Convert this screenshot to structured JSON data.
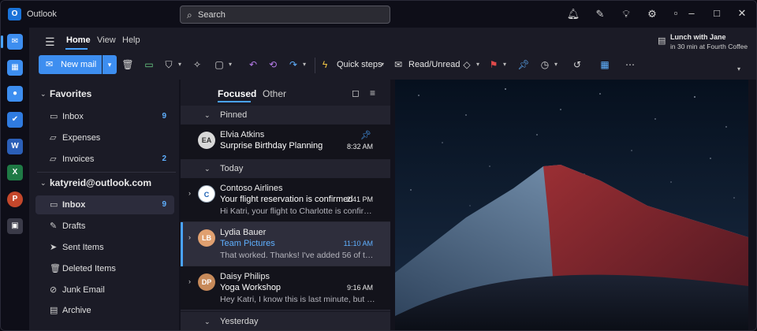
{
  "app": {
    "name": "Outlook",
    "logo": "O"
  },
  "search": {
    "placeholder": "Search"
  },
  "titlebar_icons": [
    "bell-icon",
    "sticky-note-icon",
    "lightbulb-icon",
    "gear-icon"
  ],
  "window_controls": [
    "restore-icon",
    "minimize-icon",
    "maximize-icon",
    "close-icon"
  ],
  "rail": [
    {
      "name": "mail-icon",
      "glyph": "✉",
      "color": "#3d8ef0"
    },
    {
      "name": "calendar-icon",
      "glyph": "▦",
      "color": "#3d8ef0"
    },
    {
      "name": "people-icon",
      "glyph": "●",
      "color": "#3d8ef0"
    },
    {
      "name": "todo-icon",
      "glyph": "✔",
      "color": "#2f7be0"
    },
    {
      "name": "word-icon",
      "glyph": "W",
      "color": "#2b5fb8"
    },
    {
      "name": "excel-icon",
      "glyph": "X",
      "color": "#1f7a45"
    },
    {
      "name": "powerpoint-icon",
      "glyph": "P",
      "color": "#c4472b"
    },
    {
      "name": "apps-icon",
      "glyph": "▣",
      "color": "#3a3a48"
    }
  ],
  "ribbon": {
    "tabs": [
      "Home",
      "View",
      "Help"
    ],
    "active_tab": "Home",
    "new_mail": "New mail",
    "quick_steps": "Quick steps",
    "read_unread": "Read/Unread"
  },
  "reminder": {
    "title": "Lunch with Jane",
    "subtitle": "in 30 min at Fourth Coffee"
  },
  "favorites": {
    "header": "Favorites",
    "items": [
      {
        "label": "Inbox",
        "count": "9",
        "icon": "inbox-icon"
      },
      {
        "label": "Expenses",
        "count": "",
        "icon": "folder-icon"
      },
      {
        "label": "Invoices",
        "count": "2",
        "icon": "folder-icon"
      }
    ]
  },
  "account": {
    "header": "katyreid@outlook.com",
    "items": [
      {
        "label": "Inbox",
        "count": "9",
        "icon": "inbox-icon",
        "selected": true
      },
      {
        "label": "Drafts",
        "count": "",
        "icon": "drafts-icon"
      },
      {
        "label": "Sent Items",
        "count": "",
        "icon": "send-icon"
      },
      {
        "label": "Deleted Items",
        "count": "",
        "icon": "trash-icon"
      },
      {
        "label": "Junk Email",
        "count": "",
        "icon": "junk-icon"
      },
      {
        "label": "Archive",
        "count": "",
        "icon": "archive-icon"
      }
    ]
  },
  "list": {
    "tabs": [
      "Focused",
      "Other"
    ],
    "groups": {
      "pinned": "Pinned",
      "today": "Today",
      "yesterday": "Yesterday"
    },
    "messages": [
      {
        "sender": "Elvia Atkins",
        "subject": "Surprise Birthday Planning",
        "preview": "",
        "time": "8:32 AM",
        "avatar": "EA",
        "avatar_color": "#d8d8d8",
        "pinned": true
      },
      {
        "sender": "Contoso Airlines",
        "subject": "Your flight reservation is confirmed",
        "preview": "Hi Katri, your flight to Charlotte is confirmed...",
        "time": "2:41 PM",
        "avatar": "C",
        "avatar_color": "#ffffff"
      },
      {
        "sender": "Lydia Bauer",
        "subject": "Team Pictures",
        "preview": "That worked. Thanks! I've added 56 of the...",
        "time": "11:10 AM",
        "avatar": "LB",
        "avatar_color": "#e0a070",
        "selected": true
      },
      {
        "sender": "Daisy Philips",
        "subject": "Yoga Workshop",
        "preview": "Hey Katri, I know this is last minute, but do...",
        "time": "9:16 AM",
        "avatar": "DP",
        "avatar_color": "#c78a5a"
      }
    ]
  }
}
